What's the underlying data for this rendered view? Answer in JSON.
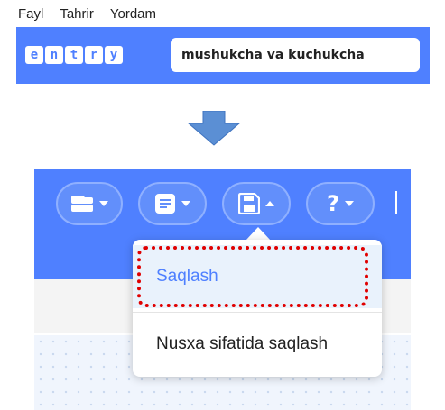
{
  "menu": {
    "items": [
      "Fayl",
      "Tahrir",
      "Yordam"
    ]
  },
  "header": {
    "logo_letters": [
      "e",
      "n",
      "t",
      "r",
      "y"
    ],
    "project_name": "mushukcha va kuchukcha",
    "accent_color": "#4f80ff"
  },
  "arrow": {
    "icon": "down-arrow-icon",
    "color": "#5b8fd4"
  },
  "toolbar": {
    "buttons": [
      {
        "icon": "blocks-icon",
        "caret": "down"
      },
      {
        "icon": "document-icon",
        "caret": "down"
      },
      {
        "icon": "save-disk-icon",
        "caret": "up"
      },
      {
        "icon": "help-question-icon",
        "label": "?",
        "caret": "down"
      }
    ]
  },
  "dropdown": {
    "items": [
      {
        "label": "Saqlash",
        "highlighted": true
      },
      {
        "label": "Nusxa sifatida saqlash"
      }
    ],
    "highlight_color": "#e00000"
  }
}
